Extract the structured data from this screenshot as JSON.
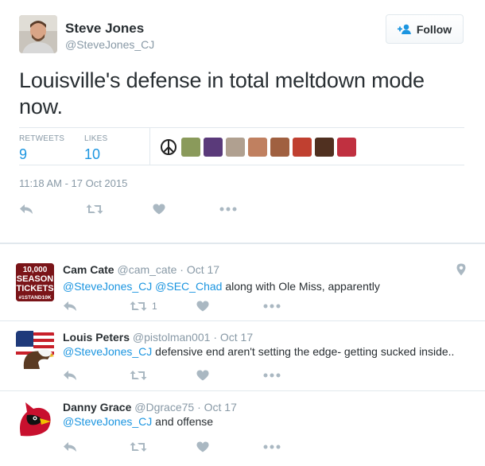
{
  "main_tweet": {
    "author_name": "Steve Jones",
    "author_handle": "@SteveJones_CJ",
    "follow_label": "Follow",
    "text": "Louisville's defense in total meltdown mode now.",
    "retweets_label": "RETWEETS",
    "retweets_count": "9",
    "likes_label": "LIKES",
    "likes_count": "10",
    "timestamp": "11:18 AM - 17 Oct 2015",
    "liker_colors": [
      "#ffffff",
      "#8a9a5b",
      "#5a3a7a",
      "#b0a090",
      "#c08060",
      "#a06040",
      "#c04030",
      "#503020",
      "#c03040"
    ]
  },
  "replies": [
    {
      "name": "Cam Cate",
      "handle": "@cam_cate",
      "date": "· Oct 17",
      "mention1": "@SteveJones_CJ",
      "mention2": "@SEC_Chad",
      "text": " along with Ole Miss, apparently",
      "retweet_count": "1",
      "avatar_lines": [
        "10,000",
        "SEASON",
        "TICKETS",
        "#1STAND10K"
      ]
    },
    {
      "name": "Louis Peters",
      "handle": "@pistolman001",
      "date": "· Oct 17",
      "mention1": "@SteveJones_CJ",
      "text": " defensive end aren't setting the edge- getting sucked inside.."
    },
    {
      "name": "Danny Grace",
      "handle": "@Dgrace75",
      "date": "· Oct 17",
      "mention1": "@SteveJones_CJ",
      "text": " and offense"
    }
  ],
  "colors": {
    "accent": "#1b95e0",
    "muted": "#8899a6",
    "border": "#e1e8ed",
    "icon": "#aab8c2"
  }
}
